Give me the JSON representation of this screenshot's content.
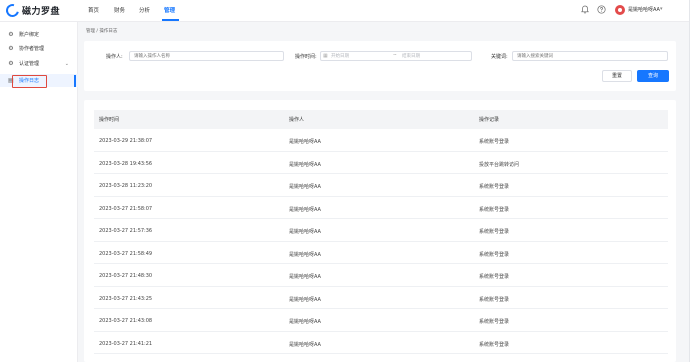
{
  "app": {
    "logo_text": "磁力罗盘"
  },
  "topnav": {
    "items": [
      "首页",
      "财务",
      "分析",
      "管理"
    ],
    "active_index": 3
  },
  "header": {
    "user_name": "是姚哈哈呀AA"
  },
  "sidebar": {
    "items": [
      "账户绑定",
      "协作者管理",
      "认证管理"
    ],
    "sub_items": [
      "操作日志"
    ]
  },
  "breadcrumb": "管理 / 操作日志",
  "filter": {
    "operator_label": "操作人:",
    "operator_placeholder": "请输入操作人名称",
    "time_label": "操作时间:",
    "start_placeholder": "开始日期",
    "range_sep": "~",
    "end_placeholder": "结束日期",
    "keyword_label": "关键词:",
    "keyword_placeholder": "请输入搜索关键词",
    "reset_label": "重置",
    "query_label": "查询"
  },
  "table": {
    "columns": [
      "操作时间",
      "操作人",
      "操作记录"
    ],
    "rows": [
      [
        "2023-03-29 21:38:07",
        "是姚哈哈呀AA",
        "系统账号登录"
      ],
      [
        "2023-03-28 19:43:56",
        "是姚哈哈呀AA",
        "投放平台跳转访问"
      ],
      [
        "2023-03-28 11:23:20",
        "是姚哈哈呀AA",
        "系统账号登录"
      ],
      [
        "2023-03-27 21:58:07",
        "是姚哈哈呀AA",
        "系统账号登录"
      ],
      [
        "2023-03-27 21:57:36",
        "是姚哈哈呀AA",
        "系统账号登录"
      ],
      [
        "2023-03-27 21:58:49",
        "是姚哈哈呀AA",
        "系统账号登录"
      ],
      [
        "2023-03-27 21:48:30",
        "是姚哈哈呀AA",
        "系统账号登录"
      ],
      [
        "2023-03-27 21:43:25",
        "是姚哈哈呀AA",
        "系统账号登录"
      ],
      [
        "2023-03-27 21:43:08",
        "是姚哈哈呀AA",
        "系统账号登录"
      ],
      [
        "2023-03-27 21:41:21",
        "是姚哈哈呀AA",
        "系统账号登录"
      ]
    ]
  },
  "colors": {
    "accent": "#1677ff",
    "highlight_box": "#e0493e"
  },
  "icons": [
    "bell-icon",
    "help-icon",
    "chevron-down-icon",
    "calendar-icon"
  ]
}
